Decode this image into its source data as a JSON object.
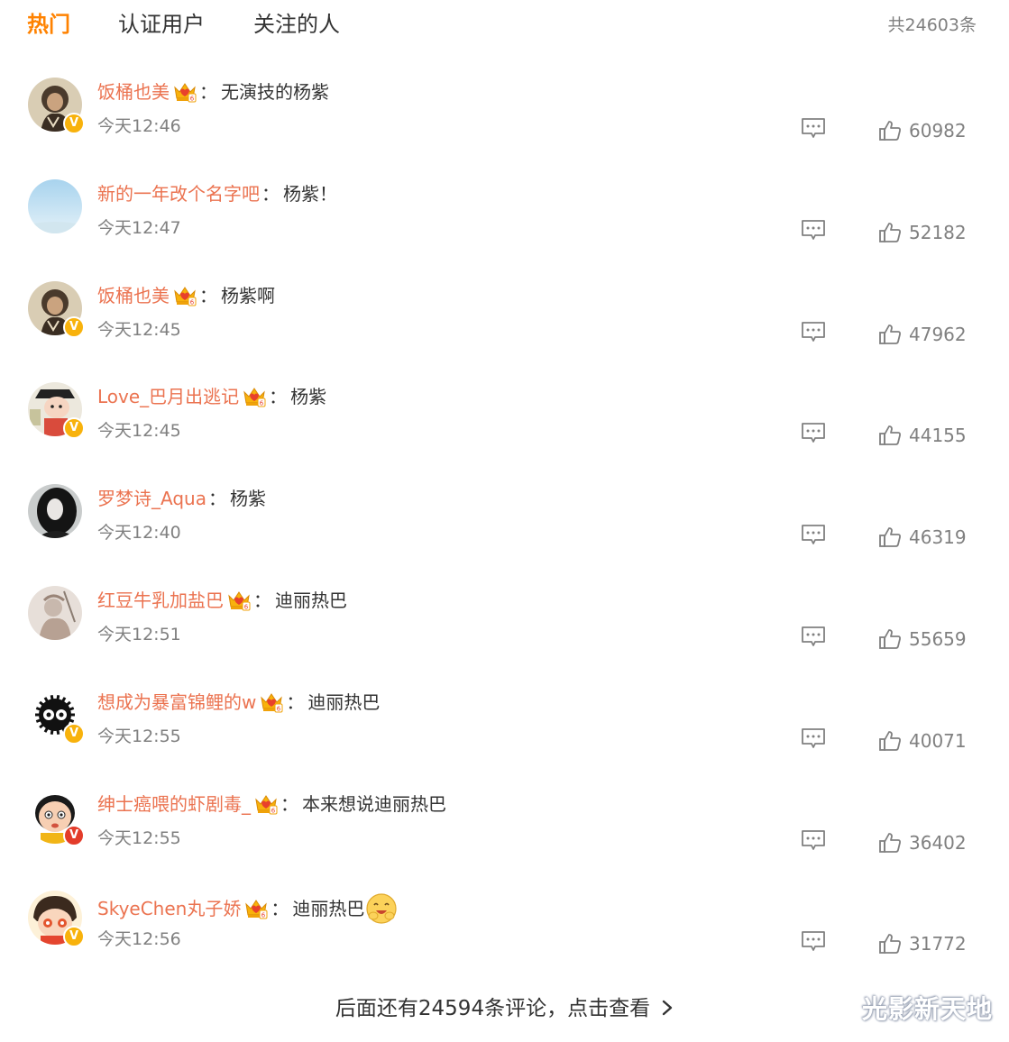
{
  "tabs": [
    {
      "label": "热门",
      "active": true
    },
    {
      "label": "认证用户",
      "active": false
    },
    {
      "label": "关注的人",
      "active": false
    }
  ],
  "total_count": "共24603条",
  "colors": {
    "accent": "#ff8200",
    "username": "#eb7350",
    "badge_gold": "#f8b20c",
    "badge_red": "#e33c2a",
    "muted": "#808080"
  },
  "comments": [
    {
      "username": "饭桶也美",
      "has_crown": true,
      "colon": "：",
      "text": "无演技的杨紫",
      "time": "今天12:46",
      "likes": "60982",
      "badge": "gold",
      "avatar": "sepia-girl"
    },
    {
      "username": "新的一年改个名字吧",
      "has_crown": false,
      "colon": "：",
      "text": "杨紫！",
      "time": "今天12:47",
      "likes": "52182",
      "badge": "none",
      "avatar": "blue-sky"
    },
    {
      "username": "饭桶也美",
      "has_crown": true,
      "colon": "：",
      "text": "杨紫啊",
      "time": "今天12:45",
      "likes": "47962",
      "badge": "gold",
      "avatar": "sepia-girl"
    },
    {
      "username": "Love_巴月出逃记",
      "has_crown": true,
      "colon": "：",
      "text": "杨紫",
      "time": "今天12:45",
      "likes": "44155",
      "badge": "gold",
      "avatar": "cartoon-boy"
    },
    {
      "username": "罗梦诗_Aqua",
      "has_crown": false,
      "colon": "：",
      "text": "杨紫",
      "time": "今天12:40",
      "likes": "46319",
      "badge": "none",
      "avatar": "dark-portrait"
    },
    {
      "username": "红豆牛乳加盐巴",
      "has_crown": true,
      "colon": "：",
      "text": "迪丽热巴",
      "time": "今天12:51",
      "likes": "55659",
      "badge": "none",
      "avatar": "sketch-warrior"
    },
    {
      "username": "想成为暴富锦鲤的w",
      "has_crown": true,
      "colon": "：",
      "text": "迪丽热巴",
      "time": "今天12:55",
      "likes": "40071",
      "badge": "gold",
      "avatar": "soot-sprite"
    },
    {
      "username": "绅士癌喂的虾剧毒_",
      "has_crown": true,
      "colon": "：",
      "text": "本来想说迪丽热巴",
      "time": "今天12:55",
      "likes": "36402",
      "badge": "red",
      "avatar": "cartoon-kid"
    },
    {
      "username": "SkyeChen丸子娇",
      "has_crown": true,
      "colon": "：",
      "text": "迪丽热巴",
      "time": "今天12:56",
      "likes": "31772",
      "badge": "gold",
      "avatar": "maruko",
      "emoji": "hug-emoji"
    }
  ],
  "more_link": "后面还有24594条评论，点击查看",
  "watermark": "光影新天地"
}
